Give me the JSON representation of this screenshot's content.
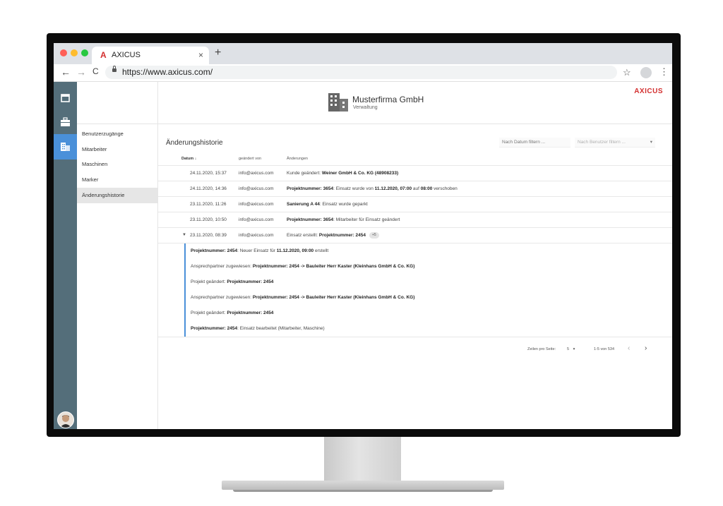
{
  "browser": {
    "tab_logo": "A",
    "tab_title": "AXICUS",
    "tab_close": "×",
    "new_tab": "+",
    "back": "←",
    "forward": "→",
    "reload": "C",
    "url": "https://www.axicus.com/",
    "bookmark": "☆",
    "menu": "⋮"
  },
  "header": {
    "company": "Musterfirma GmbH",
    "subtitle": "Verwaltung",
    "brand": "AXICUS"
  },
  "sidebar": {
    "items": [
      {
        "label": "Benutzerzugänge"
      },
      {
        "label": "Mitarbeiter"
      },
      {
        "label": "Maschinen"
      },
      {
        "label": "Marker"
      },
      {
        "label": "Änderungshistorie"
      }
    ]
  },
  "main": {
    "title": "Änderungshistorie",
    "filter_date_placeholder": "Nach Datum filtern ...",
    "filter_user_placeholder": "Nach Benutzer filtern ...",
    "filter_user_arrow": "▾",
    "columns": {
      "date": "Datum",
      "date_sort": "↓",
      "changed_by": "geändert von",
      "changes": "Änderungen"
    },
    "rows": [
      {
        "date": "24.11.2020, 15:37",
        "user": "info@axicus.com",
        "pre": "Kunde geändert: ",
        "bold": "Weiner GmbH & Co. KG (48908233)",
        "mid": "",
        "bold2": "",
        "mid2": "",
        "bold3": "",
        "post": ""
      },
      {
        "date": "24.11.2020, 14:36",
        "user": "info@axicus.com",
        "pre": "",
        "bold": "Projektnummer: 3654",
        "mid": ": Einsatz wurde von ",
        "bold2": "11.12.2020, 07:00",
        "mid2": " auf ",
        "bold3": "08:00",
        "post": " verschoben"
      },
      {
        "date": "23.11.2020, 11:26",
        "user": "info@axicus.com",
        "pre": "",
        "bold": "Sanierung A 44",
        "mid": ": Einsatz wurde geparkt",
        "bold2": "",
        "mid2": "",
        "bold3": "",
        "post": ""
      },
      {
        "date": "23.11.2020, 10:50",
        "user": "info@axicus.com",
        "pre": "",
        "bold": "Projektnummer: 3654",
        "mid": ": Mitarbeiter für Einsatz geändert",
        "bold2": "",
        "mid2": "",
        "bold3": "",
        "post": ""
      },
      {
        "date": "23.11.2020, 08:39",
        "user": "info@axicus.com",
        "pre": "Einsatz erstellt: ",
        "bold": "Projektnummer: 2454",
        "mid": "",
        "bold2": "",
        "mid2": "",
        "bold3": "",
        "post": "",
        "badge": "+5",
        "expander": "▼"
      }
    ],
    "sub_rows": [
      {
        "pre": "",
        "bold": "Projektnummer: 2454",
        "mid": ": Neuer Einsatz für ",
        "bold2": "11.12.2020, 09:00",
        "post": " erstellt"
      },
      {
        "pre": "Ansprechpartner zugewiesen: ",
        "bold": "Projektnummer: 2454 -> Bauleiter Herr Kaster (Kleinhans GmbH & Co. KG)",
        "mid": "",
        "bold2": "",
        "post": ""
      },
      {
        "pre": "Projekt geändert: ",
        "bold": "Projektnummer: 2454",
        "mid": "",
        "bold2": "",
        "post": ""
      },
      {
        "pre": "Ansprechpartner zugewiesen: ",
        "bold": "Projektnummer: 2454 -> Bauleiter Herr Kaster (Kleinhans GmbH & Co. KG)",
        "mid": "",
        "bold2": "",
        "post": ""
      },
      {
        "pre": "Projekt geändert: ",
        "bold": "Projektnummer: 2454",
        "mid": "",
        "bold2": "",
        "post": ""
      },
      {
        "pre": "",
        "bold": "Projektnummer: 2454",
        "mid": ": Einsatz bearbeitet (Mitarbeiter, Maschine)",
        "bold2": "",
        "post": ""
      }
    ],
    "pagination": {
      "rows_per_page_label": "Zeilen pro Seite:",
      "rows_per_page": "5",
      "rows_arrow": "▾",
      "range": "1-5 von 534",
      "prev": "‹",
      "next": "›"
    }
  },
  "icons": [
    "calendar-icon",
    "briefcase-icon",
    "building-icon",
    "avatar"
  ],
  "colors": {
    "rail": "#546e7a",
    "active": "#4a90d9",
    "brand": "#d32f2f"
  }
}
